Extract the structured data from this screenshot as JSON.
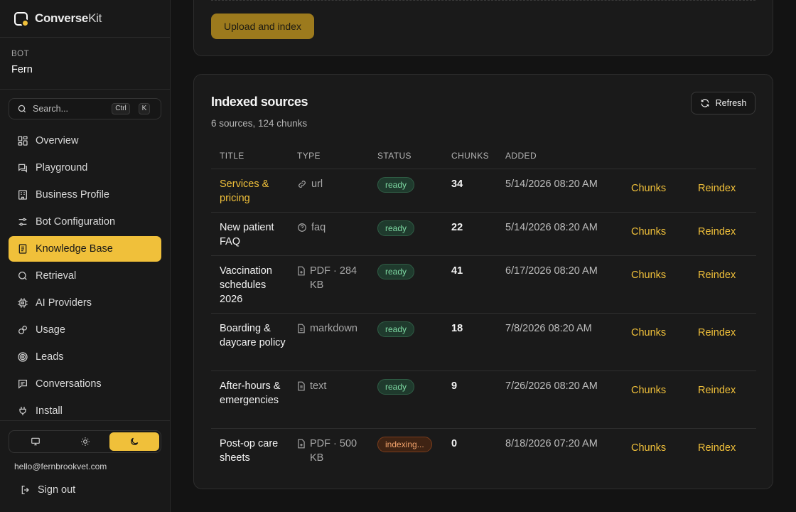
{
  "brand": {
    "name_bold": "Converse",
    "name_light": "Kit"
  },
  "bot": {
    "label": "BOT",
    "name": "Fern"
  },
  "search": {
    "placeholder": "Search...",
    "kbd_ctrl": "Ctrl",
    "kbd_k": "K"
  },
  "nav": {
    "items": [
      {
        "label": "Overview",
        "icon": "overview-icon"
      },
      {
        "label": "Playground",
        "icon": "playground-icon"
      },
      {
        "label": "Business Profile",
        "icon": "building-icon"
      },
      {
        "label": "Bot Configuration",
        "icon": "sliders-icon"
      },
      {
        "label": "Knowledge Base",
        "icon": "book-icon",
        "active": true
      },
      {
        "label": "Retrieval",
        "icon": "search-icon"
      },
      {
        "label": "AI Providers",
        "icon": "chip-icon"
      },
      {
        "label": "Usage",
        "icon": "usage-icon"
      },
      {
        "label": "Leads",
        "icon": "target-icon"
      },
      {
        "label": "Conversations",
        "icon": "chat-icon"
      },
      {
        "label": "Install",
        "icon": "plug-icon"
      }
    ]
  },
  "theme": {
    "options": [
      "system",
      "light",
      "dark"
    ],
    "selected": "dark"
  },
  "user": {
    "email": "hello@fernbrookvet.com",
    "signout_label": "Sign out"
  },
  "upload": {
    "button_label": "Upload and index"
  },
  "sources": {
    "title": "Indexed sources",
    "summary": "6 sources, 124 chunks",
    "refresh_label": "Refresh",
    "columns": [
      "TITLE",
      "TYPE",
      "STATUS",
      "CHUNKS",
      "ADDED"
    ],
    "rows": [
      {
        "title": "Services & pricing",
        "type": "url",
        "type_icon": "link-icon",
        "status": "ready",
        "chunks": "34",
        "added": "5/14/2026 08:20 AM",
        "action1": "Chunks",
        "action2": "Reindex"
      },
      {
        "title": "New patient FAQ",
        "type": "faq",
        "type_icon": "help-circle-icon",
        "status": "ready",
        "chunks": "22",
        "added": "5/14/2026 08:20 AM",
        "action1": "Chunks",
        "action2": "Reindex"
      },
      {
        "title": "Vaccination schedules 2026",
        "type": "PDF · 284 KB",
        "type_icon": "pdf-file-icon",
        "status": "ready",
        "chunks": "41",
        "added": "6/17/2026 08:20 AM",
        "action1": "Chunks",
        "action2": "Reindex"
      },
      {
        "title": "Boarding & daycare policy",
        "type": "markdown",
        "type_icon": "document-icon",
        "status": "ready",
        "chunks": "18",
        "added": "7/8/2026 08:20 AM",
        "action1": "Chunks",
        "action2": "Reindex"
      },
      {
        "title": "After-hours & emergencies",
        "type": "text",
        "type_icon": "document-icon",
        "status": "ready",
        "chunks": "9",
        "added": "7/26/2026 08:20 AM",
        "action1": "Chunks",
        "action2": "Reindex"
      },
      {
        "title": "Post-op care sheets",
        "type": "PDF · 500 KB",
        "type_icon": "pdf-file-icon",
        "status": "indexing...",
        "chunks": "0",
        "added": "8/18/2026 07:20 AM",
        "action1": "Chunks",
        "action2": "Reindex"
      }
    ]
  },
  "colors": {
    "accent": "#f0c03a",
    "background": "#131313",
    "panel": "#1a1a1a",
    "ready": "#7fdba4",
    "indexing": "#f3a36c"
  }
}
